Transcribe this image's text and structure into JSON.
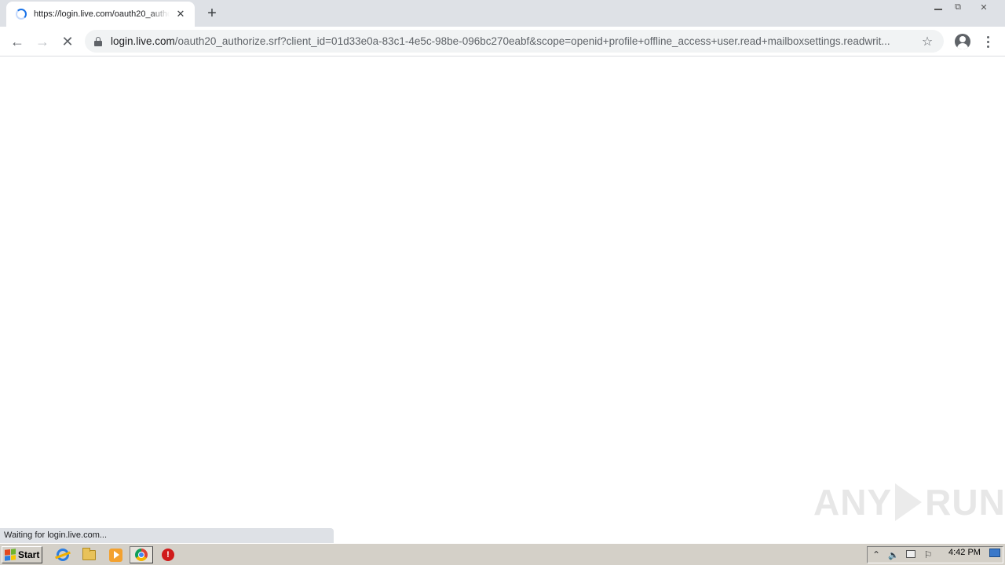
{
  "browser": {
    "tab": {
      "title": "https://login.live.com/oauth20_authorize.srf?client_id=01d33e0a-83c1-4e5c-98be-096bc270eabf",
      "close_glyph": "✕",
      "loading": true
    },
    "new_tab_glyph": "+",
    "window_controls": {
      "minimize_glyph": "▭",
      "restore_glyph": "⧉",
      "close_glyph": "✕"
    },
    "toolbar": {
      "back_glyph": "←",
      "forward_glyph": "→",
      "stop_glyph": "✕",
      "star_glyph": "☆"
    },
    "address": {
      "host": "login.live.com",
      "path": "/oauth20_authorize.srf?client_id=01d33e0a-83c1-4e5c-98be-096bc270eabf&scope=openid+profile+offline_access+user.read+mailboxsettings.readwrit..."
    },
    "status_text": "Waiting for login.live.com...",
    "icons": {
      "lock": "lock-icon",
      "profile": "profile-icon",
      "menu": "kebab-menu-icon",
      "spinner": "loading-spinner-icon"
    }
  },
  "watermark": {
    "left": "ANY",
    "right": "RUN"
  },
  "taskbar": {
    "start_label": "Start",
    "apps": [
      {
        "name": "internet-explorer-icon"
      },
      {
        "name": "file-explorer-icon"
      },
      {
        "name": "media-player-icon"
      },
      {
        "name": "chrome-icon",
        "active": true
      },
      {
        "name": "security-app-icon"
      }
    ],
    "tray": {
      "expand_glyph": "⌃",
      "volume_glyph": "🔈",
      "flag_glyph": "⚐"
    },
    "clock": "4:42 PM"
  },
  "colors": {
    "tabstrip": "#dee1e6",
    "taskbar": "#d4d0c8",
    "accent": "#1a73e8"
  }
}
